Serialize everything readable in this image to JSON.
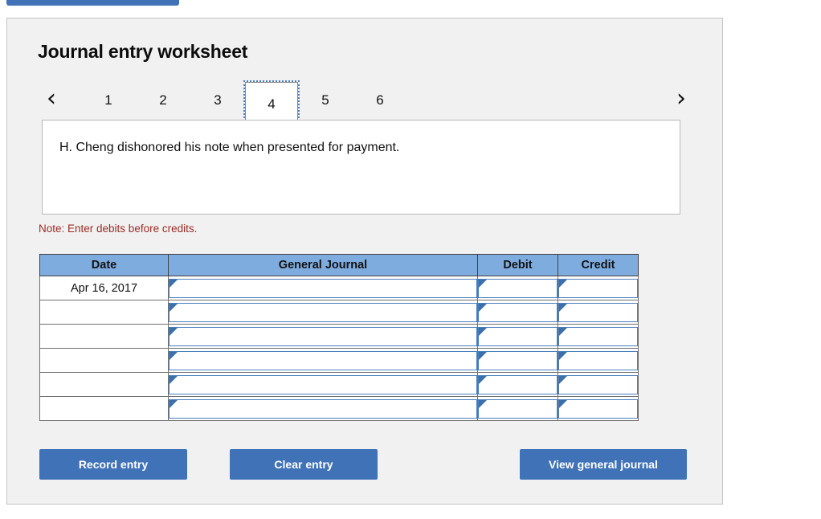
{
  "top_tab": {
    "label": ""
  },
  "panel": {
    "title": "Journal entry worksheet"
  },
  "pager": {
    "prev_icon": "chevron-left-icon",
    "prev_glyph": "‹",
    "next_icon": "chevron-right-icon",
    "next_glyph": "›",
    "tabs": [
      {
        "label": "1",
        "active": false
      },
      {
        "label": "2",
        "active": false
      },
      {
        "label": "3",
        "active": false
      },
      {
        "label": "4",
        "active": true
      },
      {
        "label": "5",
        "active": false
      },
      {
        "label": "6",
        "active": false
      }
    ],
    "active_tab": "4"
  },
  "transaction": {
    "text": "H. Cheng dishonored his note when presented for payment."
  },
  "note": {
    "text": "Note: Enter debits before credits."
  },
  "table": {
    "columns": [
      "Date",
      "General Journal",
      "Debit",
      "Credit"
    ],
    "rows": [
      {
        "date": "Apr 16, 2017",
        "general_journal": "",
        "debit": "",
        "credit": ""
      },
      {
        "date": "",
        "general_journal": "",
        "debit": "",
        "credit": ""
      },
      {
        "date": "",
        "general_journal": "",
        "debit": "",
        "credit": ""
      },
      {
        "date": "",
        "general_journal": "",
        "debit": "",
        "credit": ""
      },
      {
        "date": "",
        "general_journal": "",
        "debit": "",
        "credit": ""
      },
      {
        "date": "",
        "general_journal": "",
        "debit": "",
        "credit": ""
      }
    ]
  },
  "buttons": {
    "record": "Record entry",
    "clear": "Clear entry",
    "view": "View general journal"
  },
  "colors": {
    "button_blue": "#4072b8",
    "header_blue": "#7facdf",
    "note_red": "#9c2b24",
    "panel_gray": "#f1f1f1",
    "field_border_blue": "#4a7fbf"
  }
}
